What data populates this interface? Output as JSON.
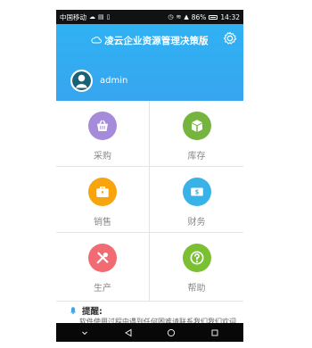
{
  "status_bar": {
    "carrier": "中国移动",
    "battery": "86%",
    "time": "14:32"
  },
  "header": {
    "app_title": "凌云企业资源管理决策版",
    "username": "admin",
    "icons": [
      "cloud-icon",
      "gear-icon",
      "avatar-icon"
    ]
  },
  "menu": {
    "items": [
      {
        "label": "采购",
        "color": "#a78bdb",
        "icon": "basket-icon"
      },
      {
        "label": "库存",
        "color": "#74b43f",
        "icon": "box-icon"
      },
      {
        "label": "销售",
        "color": "#f7a40d",
        "icon": "briefcase-icon"
      },
      {
        "label": "财务",
        "color": "#39b2e8",
        "icon": "money-icon"
      },
      {
        "label": "生产",
        "color": "#f26b72",
        "icon": "tools-icon"
      },
      {
        "label": "帮助",
        "color": "#7bbf33",
        "icon": "help-icon"
      }
    ]
  },
  "notice": {
    "title": "提醒:",
    "text": "软件使用过程中遇到任何困难请联系我们我们欢迎"
  },
  "colors": {
    "header_blue": "#32adf2",
    "status_black": "#111214"
  }
}
